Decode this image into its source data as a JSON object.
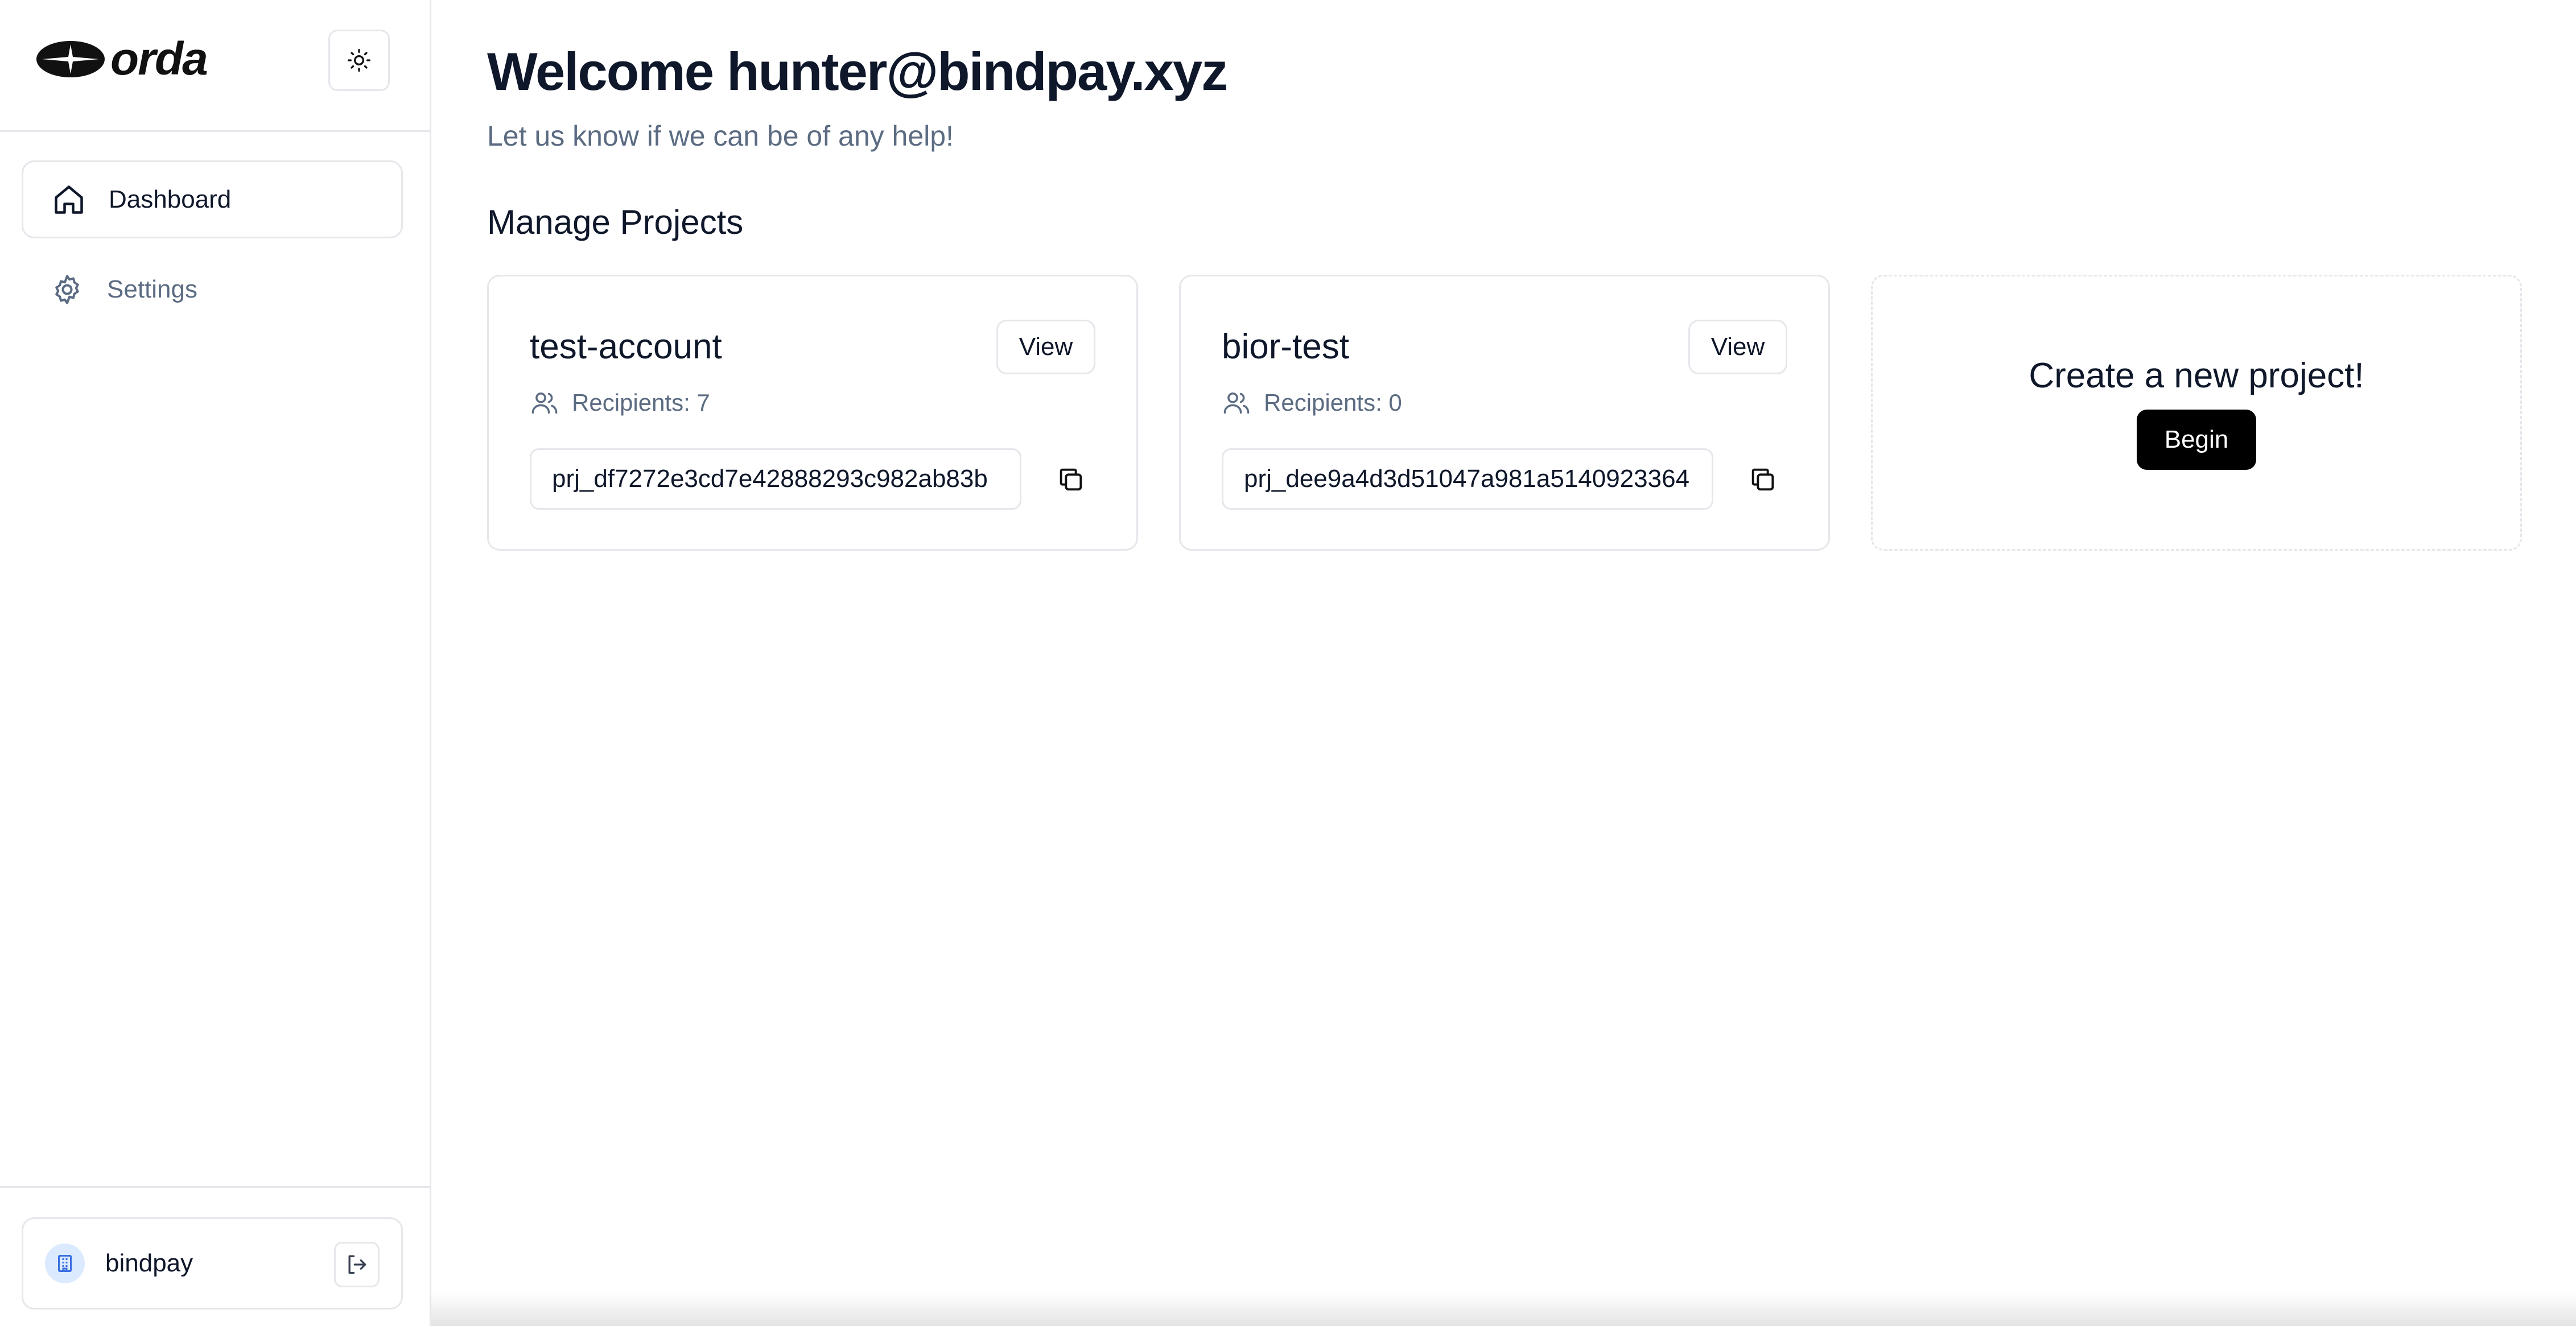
{
  "sidebar": {
    "logo_text": "orda",
    "nav": [
      {
        "label": "Dashboard",
        "icon": "home-icon",
        "active": true
      },
      {
        "label": "Settings",
        "icon": "gear-icon",
        "active": false
      }
    ],
    "org": {
      "name": "bindpay",
      "icon": "building-icon"
    }
  },
  "main": {
    "title": "Welcome hunter@bindpay.xyz",
    "subtitle": "Let us know if we can be of any help!",
    "section_title": "Manage Projects",
    "projects": [
      {
        "name": "test-account",
        "view_label": "View",
        "recipients": "Recipients: 7",
        "id": "prj_df7272e3cd7e42888293c982ab83b"
      },
      {
        "name": "bior-test",
        "view_label": "View",
        "recipients": "Recipients: 0",
        "id": "prj_dee9a4d3d51047a981a5140923364"
      }
    ],
    "new_project": {
      "title": "Create a new project!",
      "button_label": "Begin"
    }
  },
  "colors": {
    "text_primary": "#0f172a",
    "text_muted": "#5b6b82",
    "border": "#e5e7eb",
    "accent_button": "#000000",
    "org_avatar_bg": "#dbeafe"
  }
}
